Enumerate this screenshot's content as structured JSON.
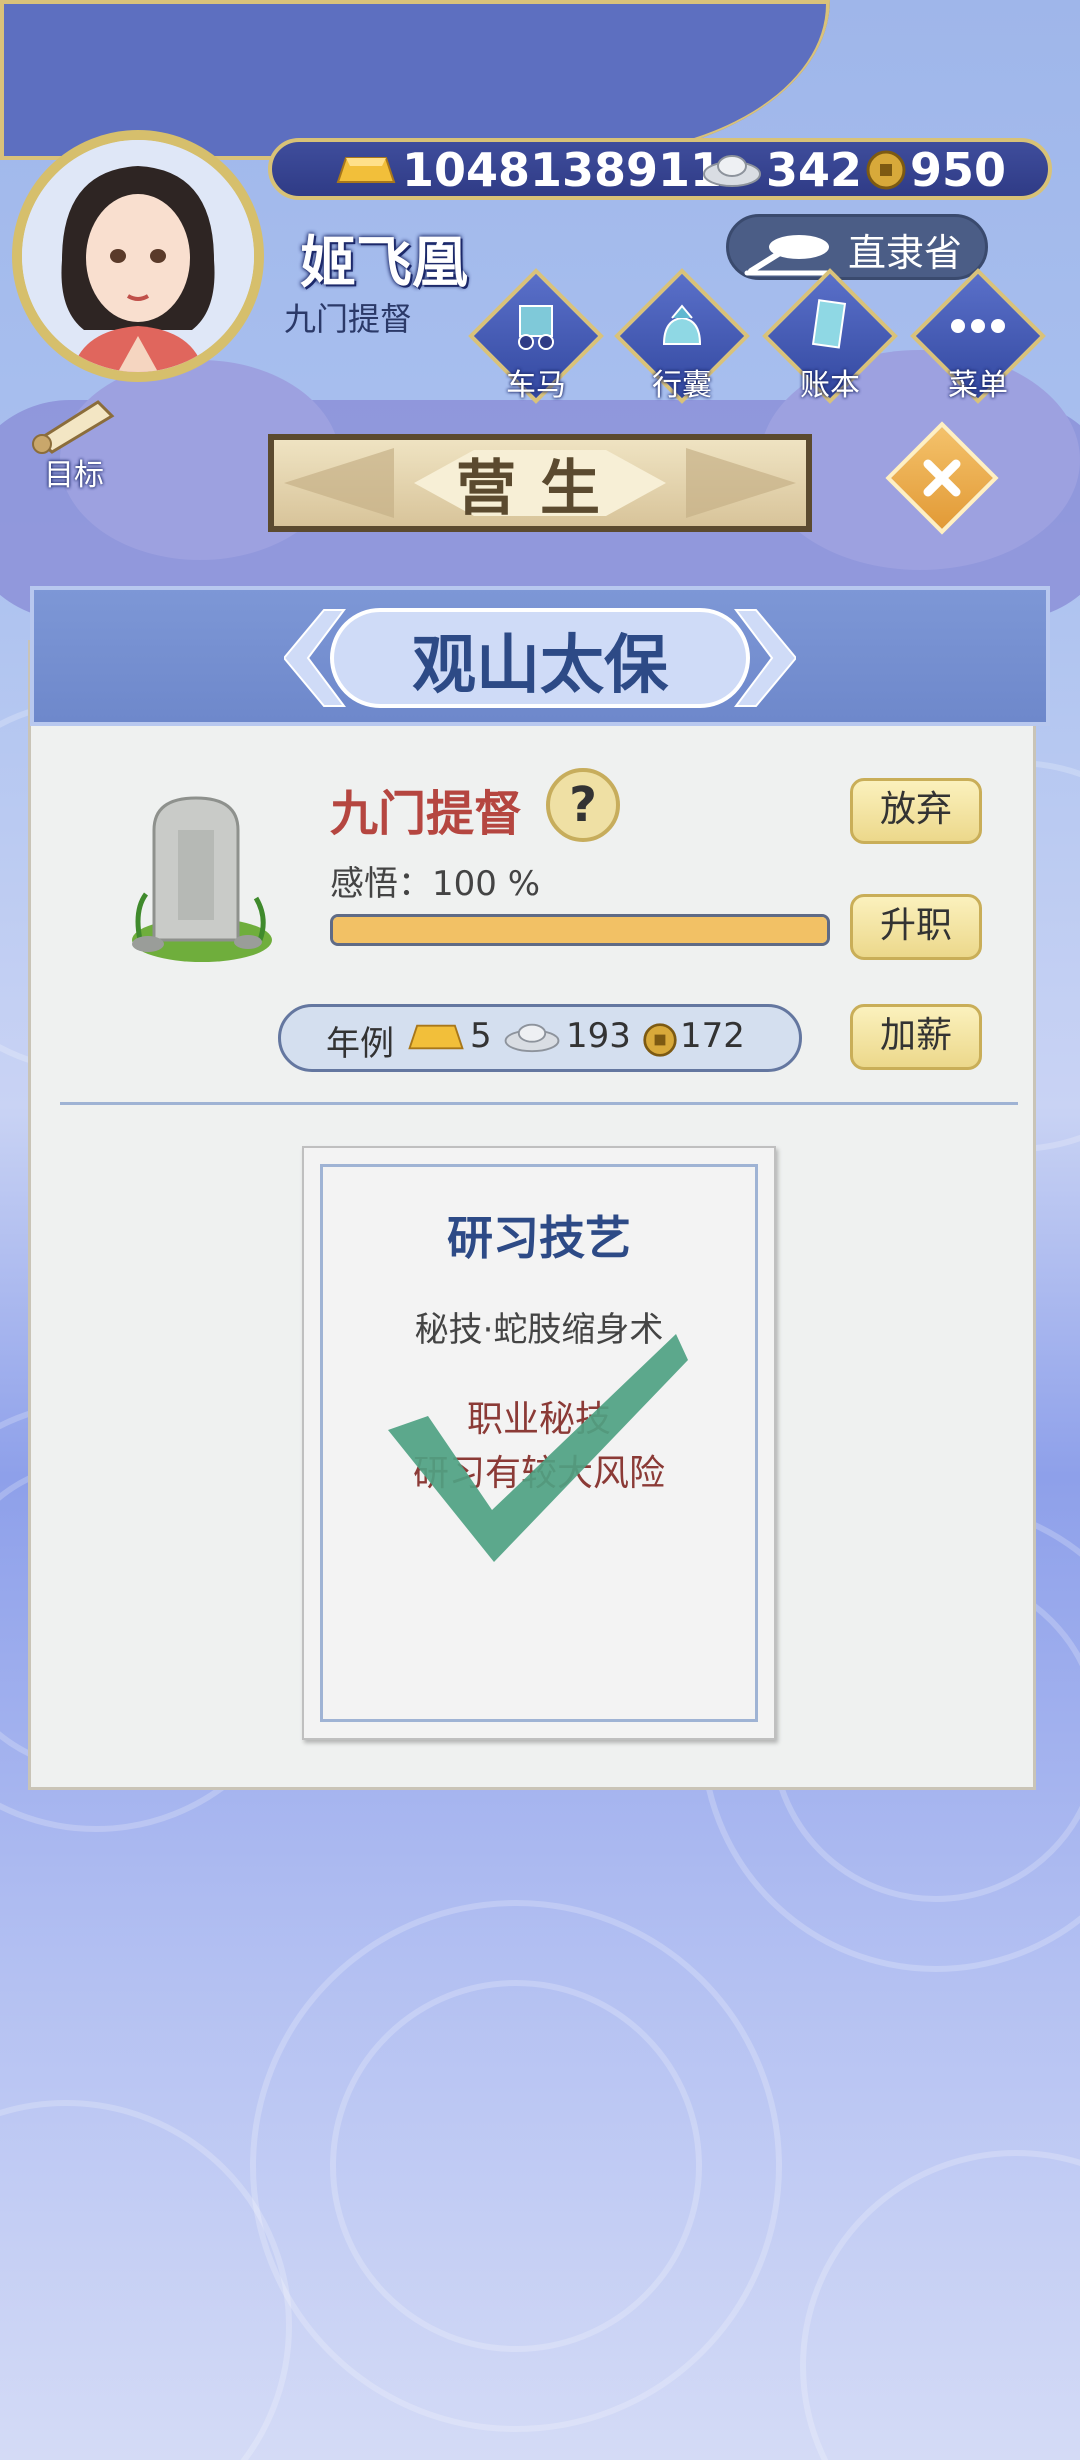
{
  "header": {
    "player_name": "姬飞凰",
    "player_rank": "九门提督",
    "province": "直隶省",
    "target_label": "目标"
  },
  "currency": {
    "gold": "1048138911",
    "silver": "342",
    "coin": "950"
  },
  "nav": {
    "items": [
      {
        "label": "车马",
        "icon": "carriage-icon"
      },
      {
        "label": "行囊",
        "icon": "bundle-icon"
      },
      {
        "label": "账本",
        "icon": "ledger-icon"
      },
      {
        "label": "菜单",
        "icon": "more-icon"
      }
    ]
  },
  "page": {
    "title": "营生"
  },
  "panel": {
    "title": "观山太保",
    "job_title": "九门提督",
    "help_glyph": "?",
    "insight_label": "感悟：100 %",
    "insight_progress": 1.0,
    "salary_label": "年例",
    "salary_gold": "5",
    "salary_silver": "193",
    "salary_coin": "172",
    "buttons": {
      "abandon": "放弃",
      "promote": "升职",
      "raise": "加薪"
    }
  },
  "card": {
    "title": "研习技艺",
    "skill": "秘技·蛇肢缩身术",
    "desc_line1": "职业秘技",
    "desc_line2": "研习有较大风险"
  },
  "colors": {
    "accent_gold": "#d6bf6c",
    "title_blue": "#2d4a86",
    "job_red": "#b54640",
    "check_green": "#5aa98a"
  }
}
